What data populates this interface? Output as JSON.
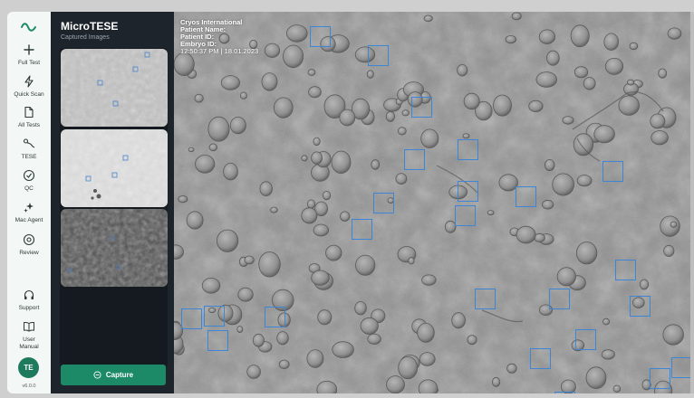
{
  "app": {
    "title": "MicroTESE",
    "subtitle": "Captured Images",
    "version": "v6.0.0"
  },
  "sidebar": {
    "items": [
      {
        "label": "Full Test",
        "icon": "plus-icon"
      },
      {
        "label": "Quick Scan",
        "icon": "bolt-icon"
      },
      {
        "label": "All Tests",
        "icon": "document-icon"
      },
      {
        "label": "TESE",
        "icon": "sperm-icon"
      },
      {
        "label": "QC",
        "icon": "check-circle-icon"
      },
      {
        "label": "Mac Agent",
        "icon": "sparkle-icon"
      },
      {
        "label": "Review",
        "icon": "review-icon"
      },
      {
        "label": "Support",
        "icon": "headphones-icon"
      },
      {
        "label": "User Manual",
        "icon": "book-icon"
      }
    ],
    "avatar_initials": "TE"
  },
  "gallery": {
    "thumbnails": [
      {
        "name": "captured-image-1",
        "tone": "light"
      },
      {
        "name": "captured-image-2",
        "tone": "bright"
      },
      {
        "name": "captured-image-3",
        "tone": "dark"
      }
    ],
    "capture_label": "Capture"
  },
  "viewer": {
    "clinic": "Cryos International",
    "patient_name": "Patient Name:",
    "patient_id": "Patient ID:",
    "embryo_id": "Embryo ID:",
    "timestamp": "12:50:37 PM | 18.01.2023"
  },
  "colors": {
    "accent": "#1c8a66",
    "detection_box": "#3d86d6",
    "panel_bg": "#1e242b",
    "rail_bg": "#f3f7f6"
  }
}
